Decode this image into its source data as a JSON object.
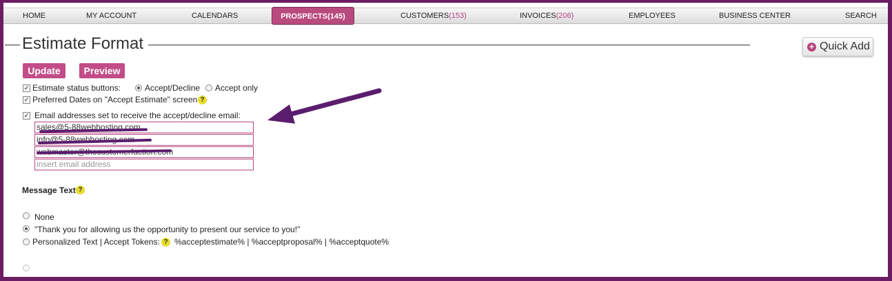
{
  "nav": {
    "home": "HOME",
    "my_account": "MY ACCOUNT",
    "calendars": "CALENDARS",
    "prospects": "PROSPECTS",
    "prospects_count": "(145)",
    "customers": "CUSTOMERS",
    "customers_count": "(153)",
    "invoices": "INVOICES",
    "invoices_count": "(206)",
    "employees": "EMPLOYEES",
    "business_center": "BUSINESS CENTER",
    "search": "SEARCH"
  },
  "page": {
    "title": "Estimate Format",
    "quick_add": "Quick Add",
    "update": "Update",
    "preview": "Preview"
  },
  "options": {
    "status_buttons_label": "Estimate status buttons:",
    "accept_decline": "Accept/Decline",
    "accept_only": "Accept only",
    "preferred_dates": "Preferred Dates on \"Accept Estimate\" screen",
    "email_label": "Email addresses set to receive the accept/decline email:"
  },
  "emails": {
    "e1": "sales@5-88webhosting.com",
    "e2": "info@5-88webhosting.com",
    "e3": "webmaster@thecustomerfaction.com",
    "placeholder": "insert email address"
  },
  "message": {
    "heading": "Message Text",
    "none": "None",
    "thanks": "\"Thank you for allowing us the opportunity to present our service to you!\"",
    "personalized": "Personalized Text | Accept Tokens:",
    "tokens": "%acceptestimate% | %acceptproposal% | %acceptquote%"
  },
  "icons": {
    "help": "?",
    "plus": "+",
    "check": "✓"
  },
  "colors": {
    "frame": "#6b1d63",
    "accent": "#c24c87",
    "arrow": "#5b1d6d",
    "help": "#e8dc2a"
  }
}
